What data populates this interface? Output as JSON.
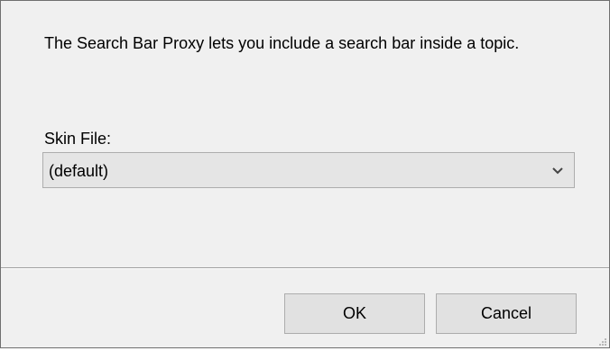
{
  "dialog": {
    "description": "The Search Bar Proxy lets you include a search bar inside a topic.",
    "skin_file": {
      "label": "Skin File:",
      "selected_value": "(default)",
      "arrow_icon": "chevron-down-icon"
    },
    "buttons": {
      "ok_label": "OK",
      "cancel_label": "Cancel"
    },
    "colors": {
      "background": "#f0f0f0",
      "button_face": "#e1e1e1",
      "combo_face": "#e5e5e5",
      "border": "#adadad"
    }
  }
}
